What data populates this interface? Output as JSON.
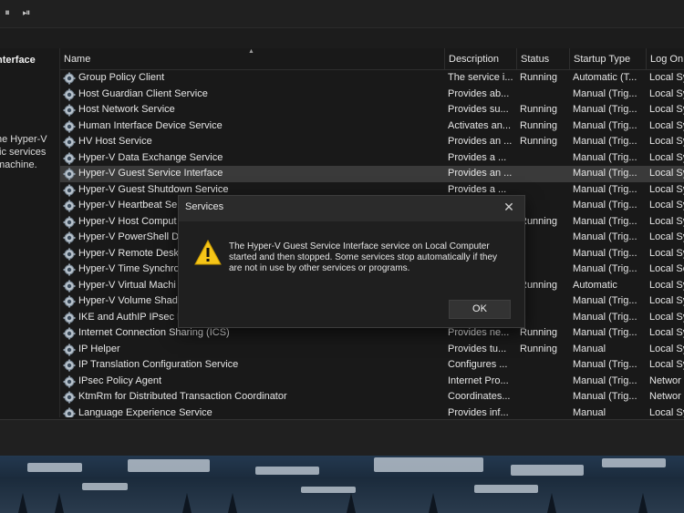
{
  "toolbar": {
    "pause_glyph": "⏸",
    "resume_glyph": "⏯"
  },
  "left_pane": {
    "title": "nterface",
    "description": "he Hyper-V\nfic services\nmachine."
  },
  "columns": [
    "Name",
    "Description",
    "Status",
    "Startup Type",
    "Log On"
  ],
  "services": [
    {
      "name": "Group Policy Client",
      "description": "The service i...",
      "status": "Running",
      "startup": "Automatic (T...",
      "logon": "Local Sys"
    },
    {
      "name": "Host Guardian Client Service",
      "description": "Provides ab...",
      "status": "",
      "startup": "Manual (Trig...",
      "logon": "Local Sys"
    },
    {
      "name": "Host Network Service",
      "description": "Provides su...",
      "status": "Running",
      "startup": "Manual (Trig...",
      "logon": "Local Sys"
    },
    {
      "name": "Human Interface Device Service",
      "description": "Activates an...",
      "status": "Running",
      "startup": "Manual (Trig...",
      "logon": "Local Sys"
    },
    {
      "name": "HV Host Service",
      "description": "Provides an ...",
      "status": "Running",
      "startup": "Manual (Trig...",
      "logon": "Local Sys"
    },
    {
      "name": "Hyper-V Data Exchange Service",
      "description": "Provides a ...",
      "status": "",
      "startup": "Manual (Trig...",
      "logon": "Local Sys"
    },
    {
      "name": "Hyper-V Guest Service Interface",
      "description": "Provides an ...",
      "status": "",
      "startup": "Manual (Trig...",
      "logon": "Local Sys",
      "selected": true
    },
    {
      "name": "Hyper-V Guest Shutdown Service",
      "description": "Provides a ...",
      "status": "",
      "startup": "Manual (Trig...",
      "logon": "Local Sys"
    },
    {
      "name": "Hyper-V Heartbeat Ser",
      "description": "",
      "status": "",
      "startup": "Manual (Trig...",
      "logon": "Local Sys"
    },
    {
      "name": "Hyper-V Host Comput",
      "description": "",
      "status": "Running",
      "startup": "Manual (Trig...",
      "logon": "Local Sys"
    },
    {
      "name": "Hyper-V PowerShell D",
      "description": "",
      "status": "",
      "startup": "Manual (Trig...",
      "logon": "Local Sys"
    },
    {
      "name": "Hyper-V Remote Desk",
      "description": "",
      "status": "",
      "startup": "Manual (Trig...",
      "logon": "Local Sys"
    },
    {
      "name": "Hyper-V Time Synchro",
      "description": "",
      "status": "",
      "startup": "Manual (Trig...",
      "logon": "Local Se"
    },
    {
      "name": "Hyper-V Virtual Machi",
      "description": "",
      "status": "Running",
      "startup": "Automatic",
      "logon": "Local Sys"
    },
    {
      "name": "Hyper-V Volume Shad",
      "description": "",
      "status": "",
      "startup": "Manual (Trig...",
      "logon": "Local Sys"
    },
    {
      "name": "IKE and AuthIP IPsec K",
      "description": "",
      "status": "",
      "startup": "Manual (Trig...",
      "logon": "Local Sys"
    },
    {
      "name": "Internet Connection Sharing (ICS)",
      "description": "Provides ne...",
      "status": "Running",
      "startup": "Manual (Trig...",
      "logon": "Local Sys"
    },
    {
      "name": "IP Helper",
      "description": "Provides tu...",
      "status": "Running",
      "startup": "Manual",
      "logon": "Local Sys"
    },
    {
      "name": "IP Translation Configuration Service",
      "description": "Configures ...",
      "status": "",
      "startup": "Manual (Trig...",
      "logon": "Local Sys"
    },
    {
      "name": "IPsec Policy Agent",
      "description": "Internet Pro...",
      "status": "",
      "startup": "Manual (Trig...",
      "logon": "Networ"
    },
    {
      "name": "KtmRm for Distributed Transaction Coordinator",
      "description": "Coordinates...",
      "status": "",
      "startup": "Manual (Trig...",
      "logon": "Networ"
    },
    {
      "name": "Language Experience Service",
      "description": "Provides inf...",
      "status": "",
      "startup": "Manual",
      "logon": "Local Sys"
    }
  ],
  "dialog": {
    "title": "Services",
    "close_glyph": "✕",
    "message": "The Hyper-V Guest Service Interface service on Local Computer started and then stopped. Some services stop automatically if they are not in use by other services or programs.",
    "ok_label": "OK"
  },
  "colors": {
    "warning": "#f5c518",
    "selected_row": "#3a3a3a"
  }
}
